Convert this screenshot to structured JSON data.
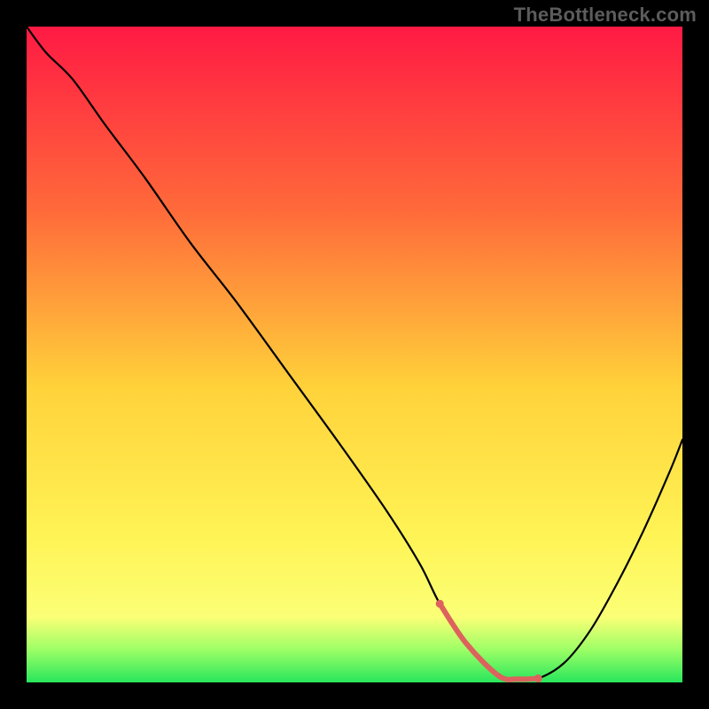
{
  "watermark": "TheBottleneck.com",
  "colors": {
    "bg": "#000000",
    "watermark": "#5c5c5c",
    "curve": "#000000",
    "highlight_stroke": "#dd625d",
    "highlight_fill": "#dd625d",
    "grad_top": "#ff1a44",
    "grad_mid1": "#ff6a3a",
    "grad_mid2": "#ffd23a",
    "grad_mid3": "#fff456",
    "grad_bottom_yellow": "#fbff76",
    "grad_green_light": "#9dff66",
    "grad_green": "#28e65c"
  },
  "chart_data": {
    "type": "line",
    "title": "",
    "xlabel": "",
    "ylabel": "",
    "xlim": [
      0,
      100
    ],
    "ylim": [
      0,
      100
    ],
    "series": [
      {
        "name": "bottleneck-curve",
        "x": [
          0,
          3,
          7,
          12,
          18,
          25,
          32,
          40,
          48,
          55,
          60,
          63,
          67,
          72,
          75,
          78,
          82,
          86,
          90,
          94,
          98,
          100
        ],
        "y": [
          100,
          96,
          92,
          85,
          77,
          67,
          58,
          47,
          36,
          26,
          18,
          12,
          6,
          1,
          0.5,
          0.6,
          3,
          8,
          15,
          23,
          32,
          37
        ]
      }
    ],
    "highlight_segment": {
      "series": "bottleneck-curve",
      "x_start": 63,
      "x_end": 78
    }
  }
}
